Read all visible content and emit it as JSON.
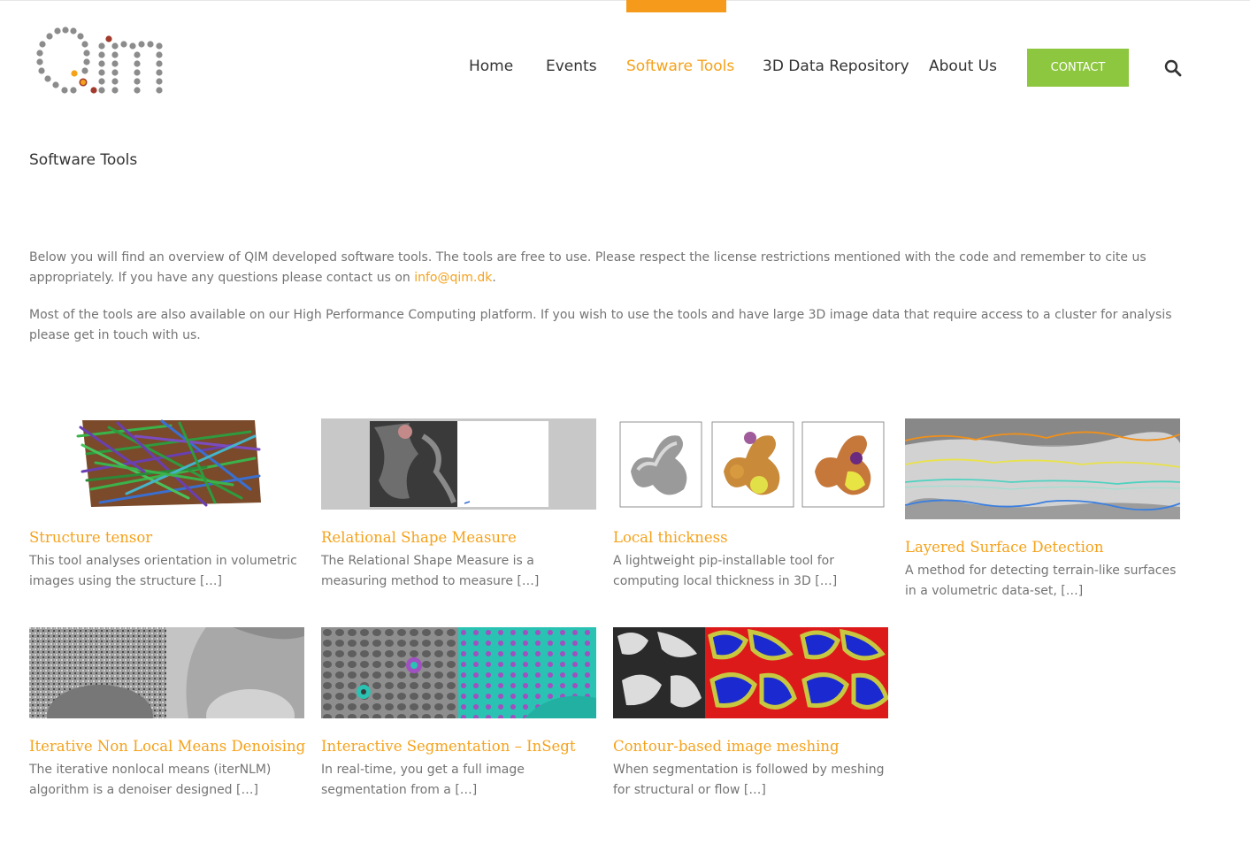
{
  "nav": {
    "items": [
      {
        "label": "Home",
        "active": false
      },
      {
        "label": "Events",
        "active": false
      },
      {
        "label": "Software Tools",
        "active": true
      },
      {
        "label": "3D Data Repository",
        "active": false
      },
      {
        "label": "About Us",
        "active": false
      }
    ],
    "contact_label": "CONTACT",
    "search_icon": "search-icon"
  },
  "page": {
    "title": "Software Tools",
    "intro_p1_text": "Below you will find an overview of QIM developed software tools. The tools are free to use. Please respect the license restrictions mentioned with the code and remember to cite us appropriately. If you have any questions please contact us on ",
    "intro_p1_link": "info@qim.dk",
    "intro_p1_end": ".",
    "intro_p2": "Most of the tools are also available on our High Performance Computing platform. If you wish to use the tools and have large 3D image data that require access to a cluster for analysis please get in touch with us."
  },
  "colors": {
    "accent": "#f5a21b",
    "contact_button": "#8dc63f",
    "text": "#747474",
    "heading": "#333333"
  },
  "tools": [
    {
      "title": "Structure tensor",
      "excerpt": "This tool analyses orientation in volumetric images using the structure […]"
    },
    {
      "title": "Relational Shape Measure",
      "excerpt": "The Relational Shape Measure is a measuring method to measure […]"
    },
    {
      "title": "Local thickness",
      "excerpt": "A lightweight pip-installable tool for computing local thickness in 3D […]"
    },
    {
      "title": "Layered Surface Detection",
      "excerpt": "A method for detecting terrain-like surfaces in a volumetric data-set, […]"
    },
    {
      "title": "Iterative Non Local Means Denoising",
      "excerpt": "The iterative nonlocal means (iterNLM) algorithm is a denoiser designed […]"
    },
    {
      "title": "Interactive Segmentation – InSegt",
      "excerpt": "In real-time, you get a full image segmentation from a […]"
    },
    {
      "title": "Contour-based image meshing",
      "excerpt": "When segmentation is followed by meshing for structural or flow […]"
    }
  ]
}
